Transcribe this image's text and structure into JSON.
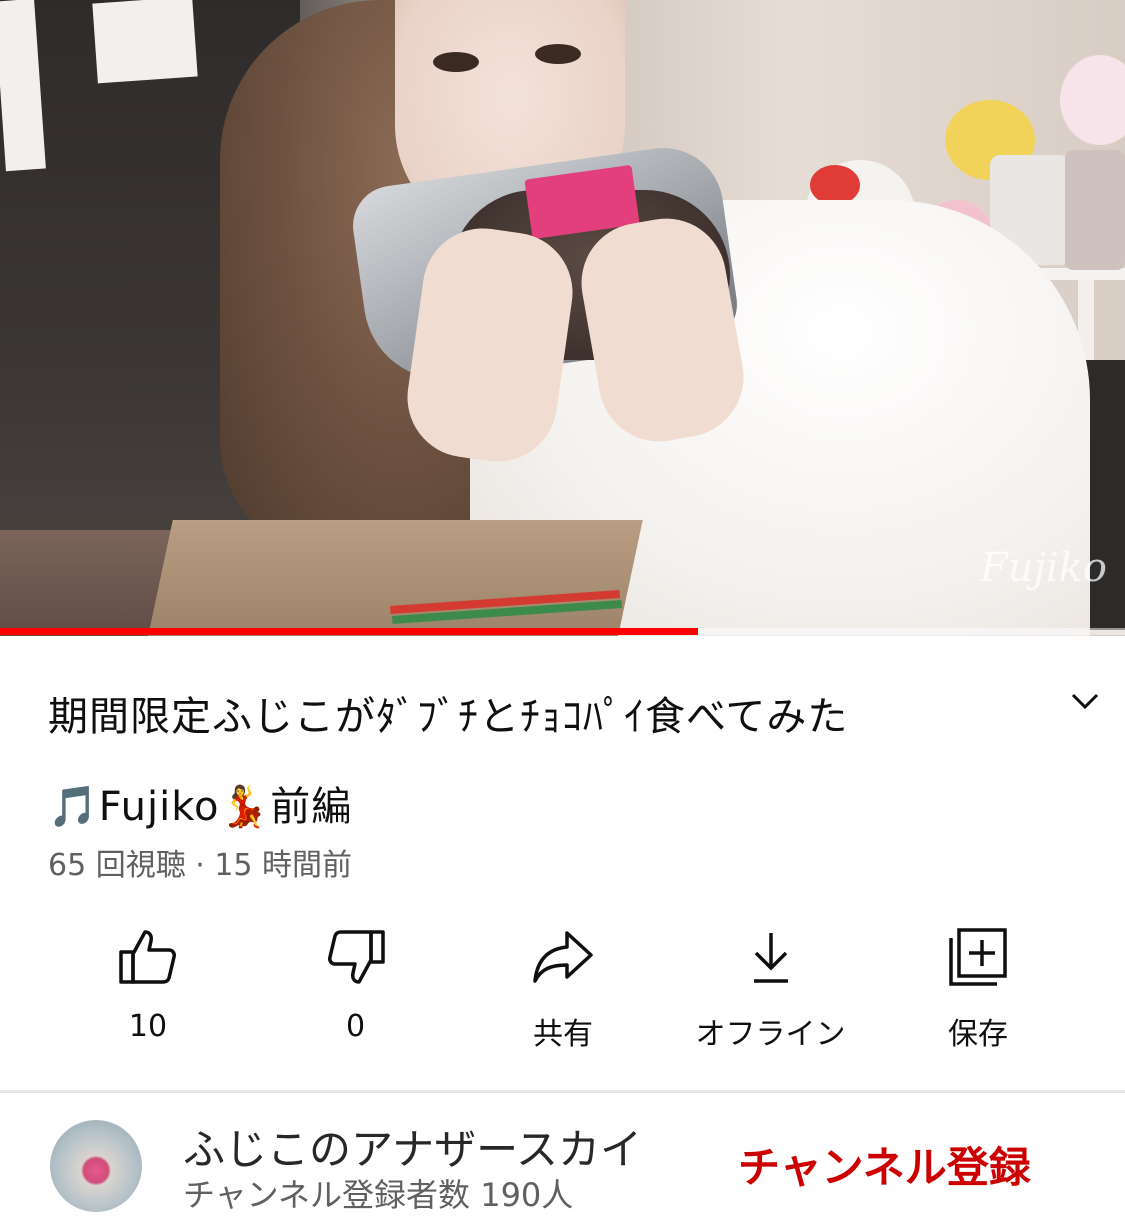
{
  "video": {
    "watermark": "Fujiko",
    "progress_fraction": 0.62,
    "progress_color": "#ff0000"
  },
  "title": {
    "line1": "期間限定ふじこがﾀﾞﾌﾞﾁとﾁｮｺﾊﾟｲ食べてみた",
    "line2": "🎵Fujiko💃前編"
  },
  "meta": {
    "text": "65 回視聴 · 15 時間前"
  },
  "actions": [
    {
      "name": "like",
      "icon": "thumbs-up-icon",
      "label": "10"
    },
    {
      "name": "dislike",
      "icon": "thumbs-down-icon",
      "label": "0"
    },
    {
      "name": "share",
      "icon": "share-icon",
      "label": "共有"
    },
    {
      "name": "offline",
      "icon": "download-icon",
      "label": "オフライン"
    },
    {
      "name": "save",
      "icon": "add-to-playlist-icon",
      "label": "保存"
    }
  ],
  "channel": {
    "name": "ふじこのアナザースカイ",
    "subscribers": "チャンネル登録者数 190人",
    "subscribe_label": "チャンネル登録",
    "subscribe_color": "#cc0000"
  }
}
